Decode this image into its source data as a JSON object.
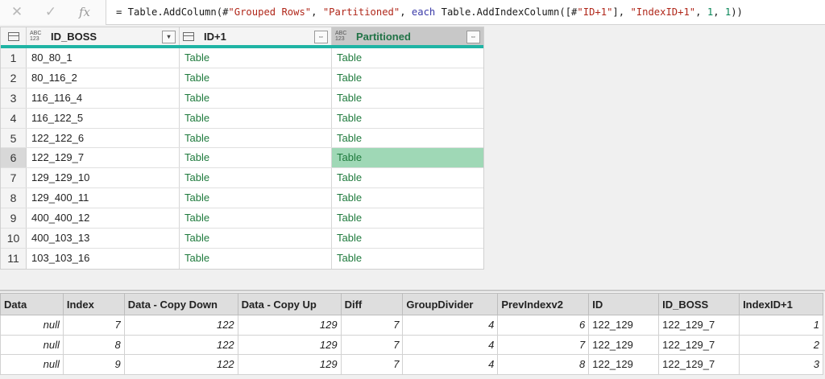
{
  "formula_bar": {
    "cancel_icon": "close-icon",
    "confirm_icon": "check-icon",
    "fx_label": "fx",
    "formula": {
      "p1": "= Table.AddColumn(#",
      "s1": "\"Grouped Rows\"",
      "p2": ", ",
      "s2": "\"Partitioned\"",
      "p3": ", ",
      "k1": "each",
      "p4": " Table.AddIndexColumn([#",
      "s3": "\"ID+1\"",
      "p5": "], ",
      "s4": "\"IndexID+1\"",
      "p6": ", ",
      "n1": "1",
      "p7": ", ",
      "n2": "1",
      "p8": "))"
    }
  },
  "grid": {
    "columns": [
      {
        "name": "ID_BOSS",
        "type_top": "ABC",
        "type_bottom": "123",
        "button": "▾"
      },
      {
        "name": "ID+1",
        "type_icon": "table-icon",
        "button": "⇔"
      },
      {
        "name": "Partitioned",
        "type_top": "ABC",
        "type_bottom": "123",
        "button": "⇔"
      }
    ],
    "accent_color": "#1fb4a4",
    "selected_row": 6,
    "rows": [
      {
        "n": "1",
        "id_boss": "80_80_1",
        "id1": "Table",
        "partitioned": "Table"
      },
      {
        "n": "2",
        "id_boss": "80_116_2",
        "id1": "Table",
        "partitioned": "Table"
      },
      {
        "n": "3",
        "id_boss": "116_116_4",
        "id1": "Table",
        "partitioned": "Table"
      },
      {
        "n": "4",
        "id_boss": "116_122_5",
        "id1": "Table",
        "partitioned": "Table"
      },
      {
        "n": "5",
        "id_boss": "122_122_6",
        "id1": "Table",
        "partitioned": "Table"
      },
      {
        "n": "6",
        "id_boss": "122_129_7",
        "id1": "Table",
        "partitioned": "Table"
      },
      {
        "n": "7",
        "id_boss": "129_129_10",
        "id1": "Table",
        "partitioned": "Table"
      },
      {
        "n": "8",
        "id_boss": "129_400_11",
        "id1": "Table",
        "partitioned": "Table"
      },
      {
        "n": "9",
        "id_boss": "400_400_12",
        "id1": "Table",
        "partitioned": "Table"
      },
      {
        "n": "10",
        "id_boss": "400_103_13",
        "id1": "Table",
        "partitioned": "Table"
      },
      {
        "n": "11",
        "id_boss": "103_103_16",
        "id1": "Table",
        "partitioned": "Table"
      }
    ]
  },
  "preview": {
    "headers": [
      "Data",
      "Index",
      "Data - Copy Down",
      "Data - Copy Up",
      "Diff",
      "GroupDivider",
      "PrevIndexv2",
      "ID",
      "ID_BOSS",
      "IndexID+1"
    ],
    "rows": [
      [
        "null",
        "7",
        "122",
        "129",
        "7",
        "4",
        "6",
        "122_129",
        "122_129_7",
        "1"
      ],
      [
        "null",
        "8",
        "122",
        "129",
        "7",
        "4",
        "7",
        "122_129",
        "122_129_7",
        "2"
      ],
      [
        "null",
        "9",
        "122",
        "129",
        "7",
        "4",
        "8",
        "122_129",
        "122_129_7",
        "3"
      ]
    ]
  }
}
